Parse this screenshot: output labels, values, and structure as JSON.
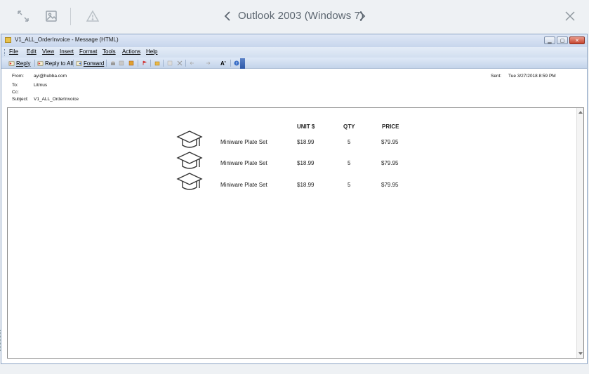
{
  "viewer": {
    "title": "Outlook 2003 (Windows 7)",
    "icons": {
      "expand": "expand-arrows-icon",
      "image": "image-icon",
      "warning": "warning-triangle-icon",
      "prev": "chevron-left-icon",
      "next": "chevron-right-icon",
      "close": "close-icon"
    }
  },
  "window": {
    "title": "V1_ALL_OrderInvoice - Message (HTML)",
    "menu": [
      "File",
      "Edit",
      "View",
      "Insert",
      "Format",
      "Tools",
      "Actions",
      "Help"
    ],
    "toolbar": {
      "reply": "Reply",
      "reply_all": "Reply to All",
      "forward": "Forward"
    }
  },
  "message": {
    "from_label": "From:",
    "from": "ayi@hubba.com",
    "to_label": "To:",
    "to": "Litmus",
    "cc_label": "Cc:",
    "cc": "",
    "subject_label": "Subject:",
    "subject": "V1_ALL_OrderInvoice",
    "sent_label": "Sent:",
    "sent": "Tue 3/27/2018 8:59 PM"
  },
  "invoice": {
    "columns": [
      "UNIT $",
      "QTY",
      "PRICE"
    ],
    "rows": [
      {
        "item": "Miniware Plate Set",
        "unit": "$18.99",
        "qty": "5",
        "price": "$79.95"
      },
      {
        "item": "Miniware Plate Set",
        "unit": "$18.99",
        "qty": "5",
        "price": "$79.95"
      },
      {
        "item": "Miniware Plate Set",
        "unit": "$18.99",
        "qty": "5",
        "price": "$79.95"
      }
    ]
  },
  "colors": {
    "viewer_bg": "#eef1f4",
    "window_border": "#8aa2c3",
    "toolbar_accent": "#2d58a8"
  }
}
